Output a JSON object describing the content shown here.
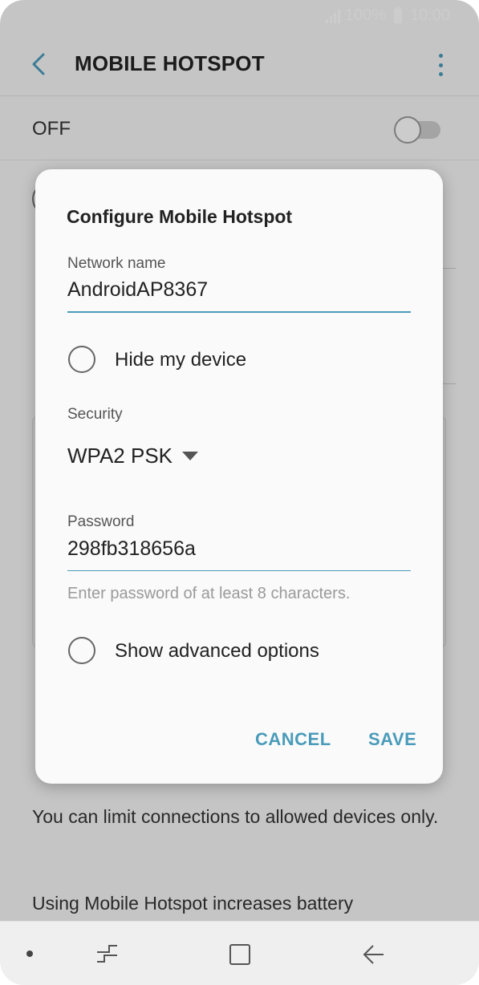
{
  "status_bar": {
    "battery": "100%",
    "time": "10:00"
  },
  "header": {
    "title": "MOBILE HOTSPOT"
  },
  "toggle_row": {
    "label": "OFF",
    "state": "off"
  },
  "background_text": {
    "limit_connections": "You can limit connections to allowed devices only.",
    "battery_notice": "Using Mobile Hotspot increases battery"
  },
  "dialog": {
    "title": "Configure Mobile Hotspot",
    "network_name_label": "Network name",
    "network_name_value": "AndroidAP8367",
    "hide_device_label": "Hide my device",
    "security_label": "Security",
    "security_value": "WPA2 PSK",
    "password_label": "Password",
    "password_value": "298fb318656a",
    "password_helper": "Enter password of at least 8 characters.",
    "advanced_label": "Show advanced options",
    "cancel_label": "CANCEL",
    "save_label": "SAVE"
  },
  "colors": {
    "accent": "#4a9bba",
    "scrim": "rgba(0,0,0,0.2)",
    "dialog_bg": "#fafafa"
  },
  "icons": {
    "back": "back-arrow-icon",
    "more": "more-vertical-icon",
    "nav_recents": "recents-icon",
    "nav_home": "home-icon",
    "nav_back": "back-nav-icon"
  }
}
